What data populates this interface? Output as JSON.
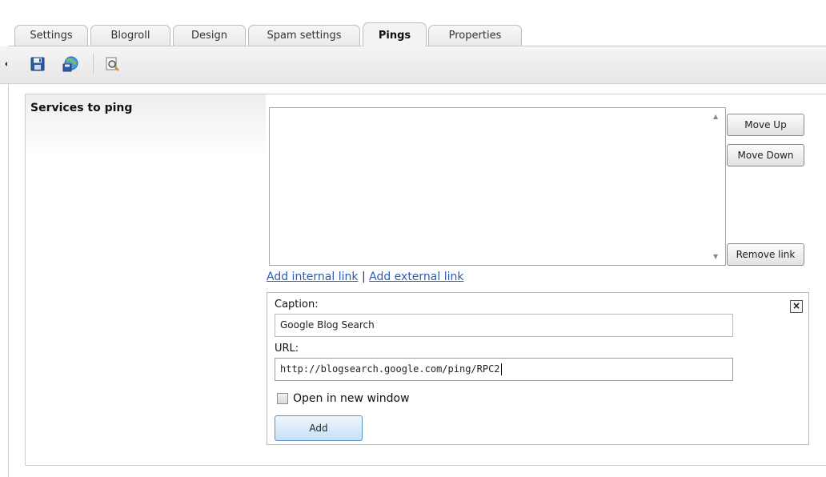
{
  "tabs": [
    {
      "label": "Settings",
      "active": false
    },
    {
      "label": "Blogroll",
      "active": false
    },
    {
      "label": "Design",
      "active": false
    },
    {
      "label": "Spam settings",
      "active": false
    },
    {
      "label": "Pings",
      "active": true
    },
    {
      "label": "Properties",
      "active": false
    }
  ],
  "toolbar": {
    "icons": [
      "collapse-arrow-icon",
      "save-icon",
      "save-publish-icon",
      "preview-icon"
    ]
  },
  "services": {
    "label": "Services to ping",
    "items": [],
    "move_up": "Move Up",
    "move_down": "Move Down",
    "remove_link": "Remove link",
    "add_internal_link": "Add internal link",
    "separator": "|",
    "add_external_link": "Add external link"
  },
  "link_form": {
    "caption_label": "Caption:",
    "caption_value": "Google Blog Search",
    "url_label": "URL:",
    "url_value": "http://blogsearch.google.com/ping/RPC2",
    "new_window_label": "Open in new window",
    "new_window_checked": false,
    "add_button": "Add",
    "close": "×"
  },
  "colors": {
    "link": "#2a5db0",
    "add_button_border": "#5c8fc9",
    "focus_border": "#7aa3d8"
  }
}
